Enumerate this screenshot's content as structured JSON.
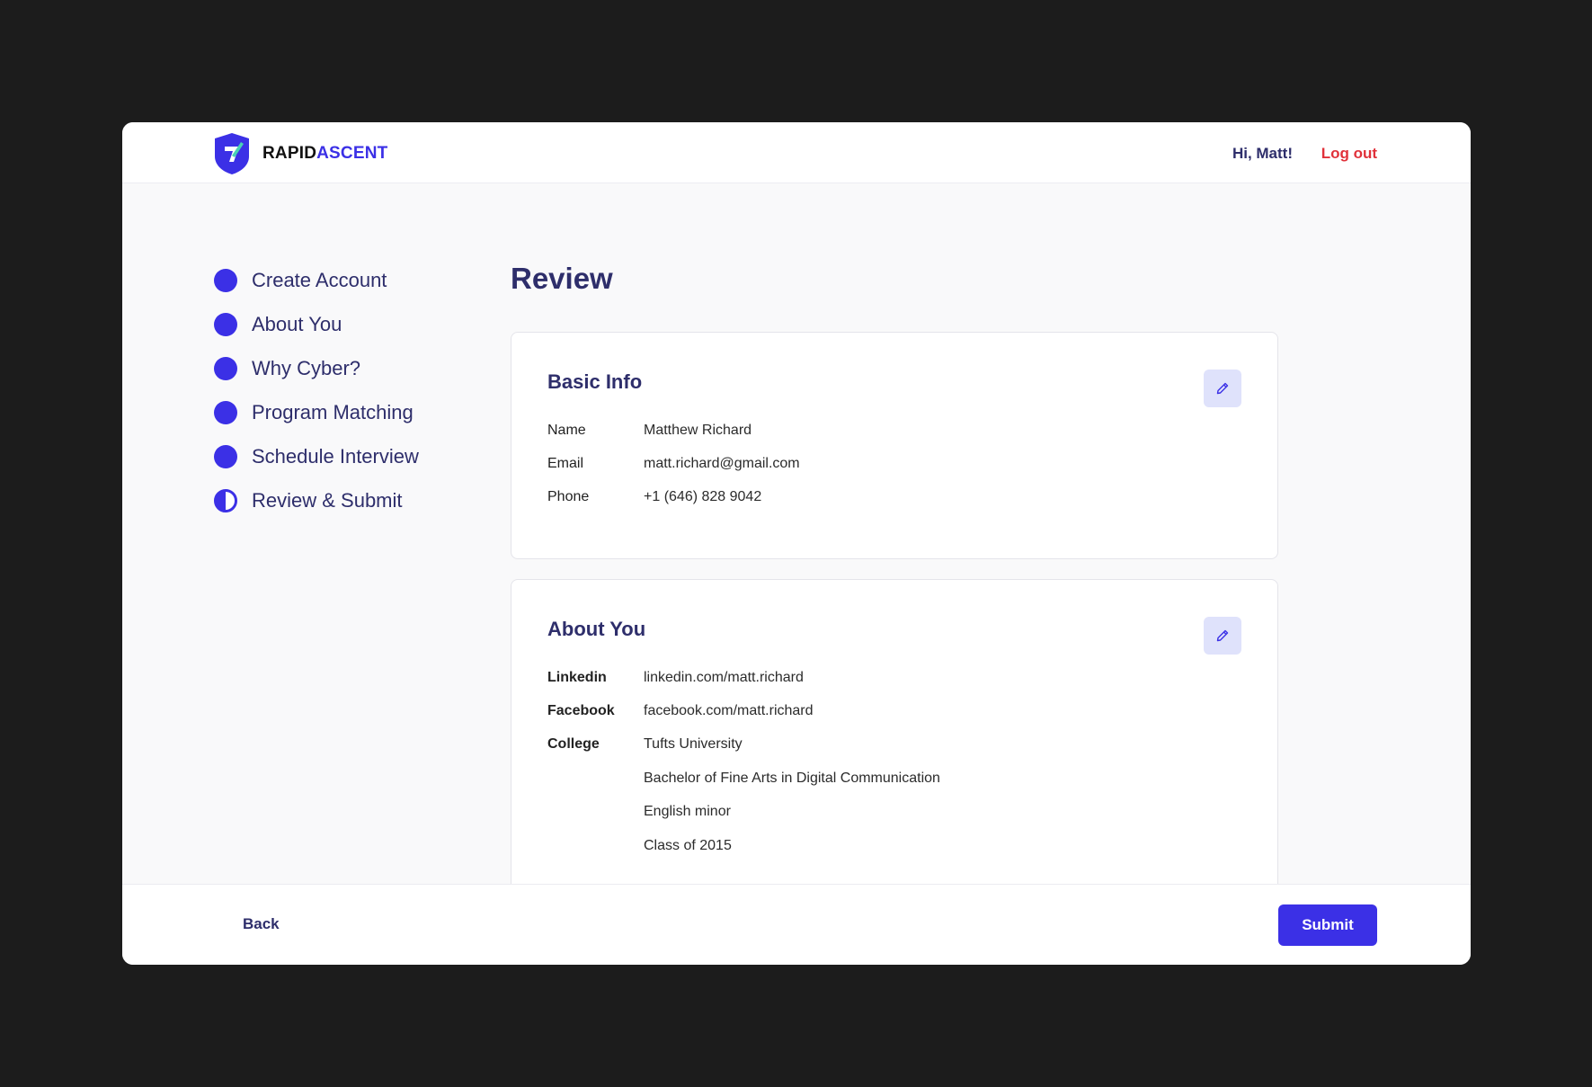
{
  "header": {
    "logo_rapid": "RAPID",
    "logo_ascent": "ASCENT",
    "greeting": "Hi, Matt!",
    "logout_label": "Log out"
  },
  "colors": {
    "accent": "#3b30e6",
    "heading": "#2e2e6b",
    "logout": "#e0313a",
    "edit_button_bg": "#dfe2fb"
  },
  "steps": [
    {
      "label": "Create Account",
      "state": "complete"
    },
    {
      "label": "About You",
      "state": "complete"
    },
    {
      "label": "Why Cyber?",
      "state": "complete"
    },
    {
      "label": "Program Matching",
      "state": "complete"
    },
    {
      "label": "Schedule Interview",
      "state": "complete"
    },
    {
      "label": "Review & Submit",
      "state": "current"
    }
  ],
  "page_title": "Review",
  "basic_info": {
    "title": "Basic Info",
    "edit_icon": "pencil-icon",
    "rows": [
      {
        "label": "Name",
        "value": "Matthew Richard"
      },
      {
        "label": "Email",
        "value": "matt.richard@gmail.com"
      },
      {
        "label": "Phone",
        "value": "+1 (646) 828 9042"
      }
    ]
  },
  "about_you": {
    "title": "About You",
    "edit_icon": "pencil-icon",
    "rows": [
      {
        "label": "Linkedin",
        "value": "linkedin.com/matt.richard"
      },
      {
        "label": "Facebook",
        "value": "facebook.com/matt.richard"
      }
    ],
    "college": {
      "label": "College",
      "lines": [
        "Tufts University",
        "Bachelor of Fine Arts in Digital Communication",
        "English minor",
        "Class of 2015"
      ]
    }
  },
  "footer": {
    "back_label": "Back",
    "submit_label": "Submit"
  }
}
